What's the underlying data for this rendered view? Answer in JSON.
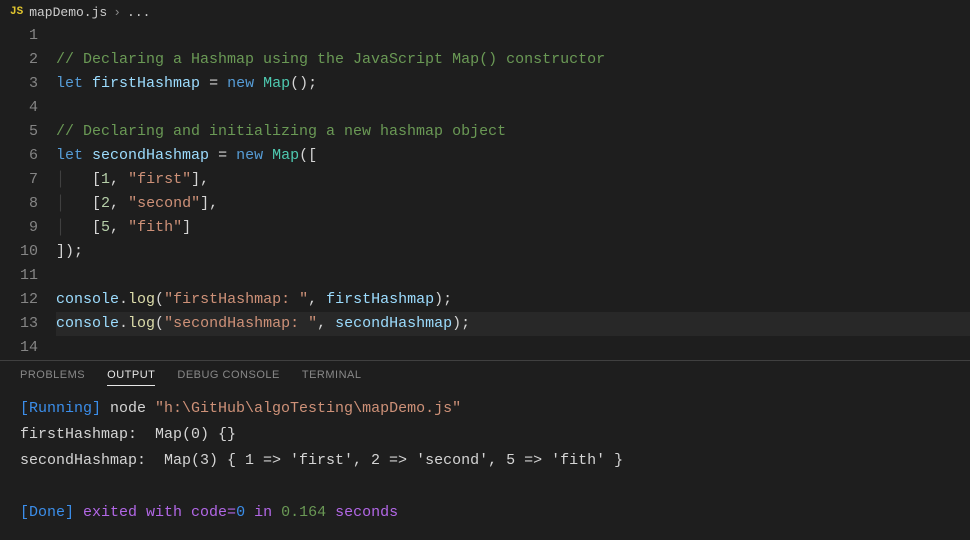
{
  "tab": {
    "badge": "JS",
    "filename": "mapDemo.js",
    "chevron": "›",
    "dots": "..."
  },
  "lineNumbers": [
    "1",
    "2",
    "3",
    "4",
    "5",
    "6",
    "7",
    "8",
    "9",
    "10",
    "11",
    "12",
    "13",
    "14"
  ],
  "code": {
    "l2_comment": "// Declaring a Hashmap using the JavaScript Map() constructor",
    "l3_let": "let",
    "l3_var": "firstHashmap",
    "l3_eq": " = ",
    "l3_new": "new",
    "l3_map": "Map",
    "l3_paren": "();",
    "l5_comment": "// Declaring and initializing a new hashmap object",
    "l6_let": "let",
    "l6_var": "secondHashmap",
    "l6_eq": " = ",
    "l6_new": "new",
    "l6_map": "Map",
    "l6_open": "([",
    "l7_open": "[",
    "l7_num": "1",
    "l7_comma": ", ",
    "l7_str": "\"first\"",
    "l7_close": "],",
    "l8_open": "[",
    "l8_num": "2",
    "l8_comma": ", ",
    "l8_str": "\"second\"",
    "l8_close": "],",
    "l9_open": "[",
    "l9_num": "5",
    "l9_comma": ", ",
    "l9_str": "\"fith\"",
    "l9_close": "]",
    "l10_close": "]);",
    "l12_console": "console",
    "l12_dot": ".",
    "l12_log": "log",
    "l12_open": "(",
    "l12_str": "\"firstHashmap: \"",
    "l12_comma": ", ",
    "l12_var": "firstHashmap",
    "l12_close": ");",
    "l13_console": "console",
    "l13_dot": ".",
    "l13_log": "log",
    "l13_open": "(",
    "l13_str": "\"secondHashmap: \"",
    "l13_comma": ", ",
    "l13_var": "secondHashmap",
    "l13_close": ");"
  },
  "panel": {
    "tabs": {
      "problems": "PROBLEMS",
      "output": "OUTPUT",
      "debug": "DEBUG CONSOLE",
      "terminal": "TERMINAL"
    }
  },
  "output": {
    "running": "[Running]",
    "node": " node ",
    "path": "\"h:\\GitHub\\algoTesting\\mapDemo.js\"",
    "line1": "firstHashmap:  Map(0) {}",
    "line2": "secondHashmap:  Map(3) { 1 => 'first', 2 => 'second', 5 => 'fith' }",
    "done": "[Done]",
    "exited": " exited with ",
    "codeEq": "code=",
    "zero": "0",
    "in": " in ",
    "time": "0.164",
    "seconds": " seconds"
  }
}
